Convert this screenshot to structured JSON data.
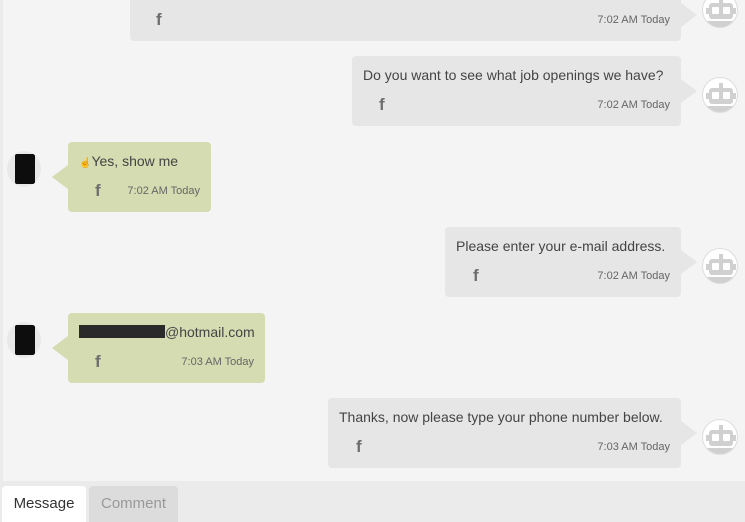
{
  "messages": [
    {
      "sender": "bot",
      "text": "",
      "time": "7:02 AM Today"
    },
    {
      "sender": "bot",
      "text": "Do you want to see what job openings we have?",
      "time": "7:02 AM Today"
    },
    {
      "sender": "user",
      "text": "Yes, show me",
      "prefix": "☝",
      "time": "7:02 AM Today"
    },
    {
      "sender": "bot",
      "text": "Please enter your e-mail address.",
      "time": "7:02 AM Today"
    },
    {
      "sender": "user",
      "text": "@hotmail.com",
      "redacted": true,
      "time": "7:03 AM Today"
    },
    {
      "sender": "bot",
      "text": "Thanks, now please type your phone number below.",
      "time": "7:03 AM Today"
    }
  ],
  "icons": {
    "channel": "facebook-icon",
    "bot_avatar": "robot-icon"
  },
  "tabs": {
    "message": "Message",
    "comment": "Comment"
  },
  "colors": {
    "bot_bubble": "#e6e6e6",
    "user_bubble": "#d5dcb2",
    "background": "#f4f4f4"
  }
}
